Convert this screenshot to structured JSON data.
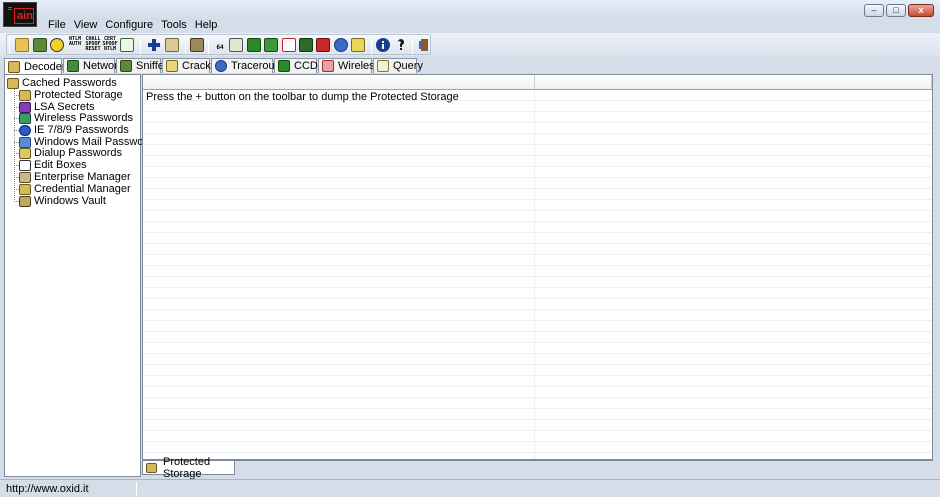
{
  "app": {
    "logo_text": "ain",
    "logo_corner": "="
  },
  "window_controls": {
    "minimize": "–",
    "maximize": "□",
    "close": "x"
  },
  "menu": [
    "File",
    "View",
    "Configure",
    "Tools",
    "Help"
  ],
  "toolbar": {
    "text_icons": [
      [
        "NTLM",
        "AUTH"
      ],
      [
        "CHALL",
        "SPOOF",
        "RESET"
      ],
      [
        "CERT",
        "SPOOF",
        "NTLM"
      ]
    ],
    "numbered_icon": "64"
  },
  "tabs": [
    {
      "label": "Decoders",
      "icon": "decoders-icon",
      "active": true
    },
    {
      "label": "Network",
      "icon": "network-icon"
    },
    {
      "label": "Sniffer",
      "icon": "sniffer-icon"
    },
    {
      "label": "Cracker",
      "icon": "cracker-icon"
    },
    {
      "label": "Traceroute",
      "icon": "traceroute-icon"
    },
    {
      "label": "CCDU",
      "icon": "ccdu-icon"
    },
    {
      "label": "Wireless",
      "icon": "wireless-icon"
    },
    {
      "label": "Query",
      "icon": "query-icon"
    }
  ],
  "tree": {
    "root": "Cached Passwords",
    "items": [
      {
        "label": "Protected Storage",
        "icon": "key-icon",
        "selected": true
      },
      {
        "label": "LSA Secrets",
        "icon": "lsa-secrets-icon"
      },
      {
        "label": "Wireless Passwords",
        "icon": "wireless-passwords-icon"
      },
      {
        "label": "IE 7/8/9 Passwords",
        "icon": "internet-explorer-icon"
      },
      {
        "label": "Windows Mail Passwords",
        "icon": "windows-mail-icon"
      },
      {
        "label": "Dialup Passwords",
        "icon": "dialup-icon"
      },
      {
        "label": "Edit Boxes",
        "icon": "edit-box-icon"
      },
      {
        "label": "Enterprise Manager",
        "icon": "enterprise-manager-icon"
      },
      {
        "label": "Credential Manager",
        "icon": "credential-manager-icon"
      },
      {
        "label": "Windows Vault",
        "icon": "vault-icon"
      }
    ]
  },
  "list": {
    "message": "Press the + button on the toolbar to dump the Protected Storage"
  },
  "bottom_tab": {
    "label": "Protected Storage",
    "icon": "key-icon"
  },
  "status": {
    "text": "http://www.oxid.it"
  },
  "colors": {
    "chrome": "#d4dde8",
    "logo_red": "#e02020",
    "grid_line": "#eceff3"
  }
}
